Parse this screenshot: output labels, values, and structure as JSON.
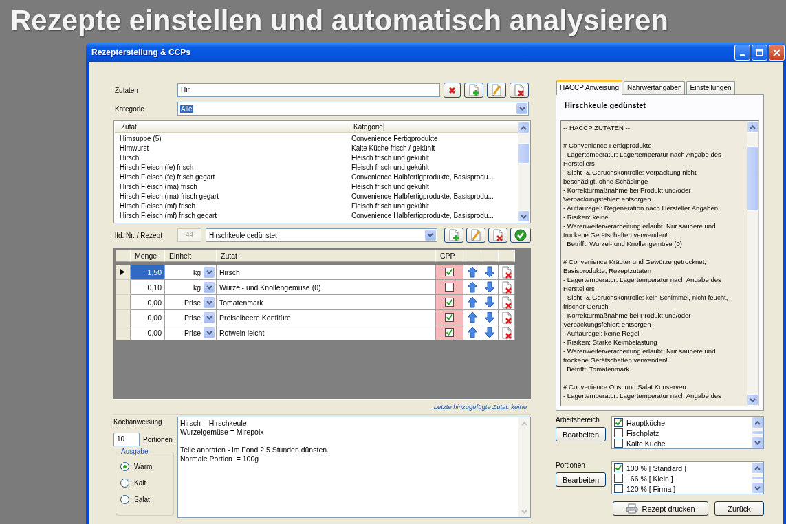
{
  "heading": "Rezepte einstellen und automatisch analysieren",
  "window": {
    "title": "Rezepterstellung & CCPs"
  },
  "ingredient_search": {
    "label": "Zutaten",
    "value": "Hir"
  },
  "category": {
    "label": "Kategorie",
    "value": "Alle",
    "highlighted": true
  },
  "ingredient_list": {
    "columns": [
      "Zutat",
      "Kategorie"
    ],
    "rows": [
      {
        "zutat": "Hirnsuppe (5)",
        "kategorie": "Convenience Fertigprodukte"
      },
      {
        "zutat": "Hirnwurst",
        "kategorie": "Kalte Küche frisch / gekühlt"
      },
      {
        "zutat": "Hirsch",
        "kategorie": "Fleisch frisch und gekühlt"
      },
      {
        "zutat": "Hirsch Fleisch (fe) frisch",
        "kategorie": "Fleisch frisch und gekühlt"
      },
      {
        "zutat": "Hirsch Fleisch (fe) frisch gegart",
        "kategorie": "Convenience Halbfertigprodukte, Basisprodu..."
      },
      {
        "zutat": "Hirsch Fleisch (ma) frisch",
        "kategorie": "Fleisch frisch und gekühlt"
      },
      {
        "zutat": "Hirsch Fleisch (ma) frisch gegart",
        "kategorie": "Convenience Halbfertigprodukte, Basisprodu..."
      },
      {
        "zutat": "Hirsch Fleisch (mf) frisch",
        "kategorie": "Fleisch frisch und gekühlt"
      },
      {
        "zutat": "Hirsch Fleisch (mf) frisch gegart",
        "kategorie": "Convenience Halbfertigprodukte, Basisprodu..."
      }
    ]
  },
  "recipe": {
    "label": "lfd. Nr. / Rezept",
    "number": "44",
    "name": "Hirschkeule gedünstet"
  },
  "recipe_table": {
    "columns": [
      "Menge",
      "Einheit",
      "Zutat",
      "CPP"
    ],
    "rows": [
      {
        "menge": "1,50",
        "einheit": "kg",
        "zutat": "Hirsch",
        "cpp": true,
        "selected": true
      },
      {
        "menge": "0,10",
        "einheit": "kg",
        "zutat": "Wurzel- und Knollengemüse (0)",
        "cpp": false,
        "selected": false
      },
      {
        "menge": "0,00",
        "einheit": "Prise",
        "zutat": "Tomatenmark",
        "cpp": true,
        "selected": false
      },
      {
        "menge": "0,00",
        "einheit": "Prise",
        "zutat": "Preiselbeere Konfitüre",
        "cpp": true,
        "selected": false
      },
      {
        "menge": "0,00",
        "einheit": "Prise",
        "zutat": "Rotwein leicht",
        "cpp": true,
        "selected": false
      }
    ]
  },
  "status": "Letzte hinzugefügte Zutat: keine",
  "cooking": {
    "label": "Kochanweisung",
    "portions_value": "10",
    "portions_label": "Portionen",
    "text": [
      [
        "Hirsch = Hirschkeule",
        "Wurzelgemüse = Mirepoix"
      ],
      [
        "Teile anbraten - im Fond 2,5 Stunden dünsten.",
        "Normale Portion  = 100g"
      ]
    ]
  },
  "output": {
    "label": "Ausgabe",
    "options": [
      {
        "label": "Warm",
        "selected": true
      },
      {
        "label": "Kalt",
        "selected": false
      },
      {
        "label": "Salat",
        "selected": false
      }
    ]
  },
  "tabs": [
    {
      "label": "HACCP Anweisung",
      "selected": true
    },
    {
      "label": "Nährwertangaben",
      "selected": false
    },
    {
      "label": "Einstellungen",
      "selected": false
    }
  ],
  "haccp": {
    "title": "Hirschkeule gedünstet",
    "text": [
      [
        "-- HACCP ZUTATEN --"
      ],
      [
        "# Convenience Fertigprodukte",
        "- Lagertemperatur: Lagertemperatur nach Angabe des",
        "Herstellers",
        "- Sicht- & Geruchskontrolle: Verpackung nicht",
        "beschädigt, ohne Schädlinge",
        "- Korrekturmaßnahme bei Produkt und/oder",
        "Verpackungsfehler: entsorgen",
        "- Auftauregel: Regeneration nach Hersteller Angaben",
        "- Risiken: keine",
        "- Warenweiterverarbeitung erlaubt. Nur saubere und",
        "trockene Gerätschaften verwenden!",
        "  Betrifft: Wurzel- und Knollengemüse (0)"
      ],
      [
        "# Convenience Kräuter und Gewürze getrocknet,",
        "Basisprodukte, Rezeptzutaten",
        "- Lagertemperatur: Lagertemperatur nach Angabe des",
        "Herstellers",
        "- Sicht- & Geruchskontrolle: kein Schimmel, nicht feucht,",
        "frischer Geruch",
        "- Korrekturmaßnahme bei Produkt und/oder",
        "Verpackungsfehler: entsorgen",
        "- Auftauregel: keine Regel",
        "- Risiken: Starke Keimbelastung",
        "- Warenweiterverarbeitung erlaubt. Nur saubere und",
        "trockene Gerätschaften verwenden!",
        "  Betrifft: Tomatenmark"
      ],
      [
        "# Convenience Obst und Salat Konserven",
        "- Lagertemperatur: Lagertemperatur nach Angabe des"
      ]
    ]
  },
  "work_area": {
    "label": "Arbeitsbereich",
    "button": "Bearbeiten",
    "items": [
      {
        "label": "Hauptküche",
        "checked": true
      },
      {
        "label": "Fischplatz",
        "checked": false
      },
      {
        "label": "Kalte Küche",
        "checked": false
      }
    ]
  },
  "portions": {
    "label": "Portionen",
    "button": "Bearbeiten",
    "items": [
      {
        "label": "100 % [ Standard ]",
        "checked": true
      },
      {
        "label": "  66 % [ Klein ]",
        "checked": false
      },
      {
        "label": "120 % [ Firma ]",
        "checked": false
      }
    ]
  },
  "buttons": [
    "Rezept drucken",
    "Zurück"
  ]
}
